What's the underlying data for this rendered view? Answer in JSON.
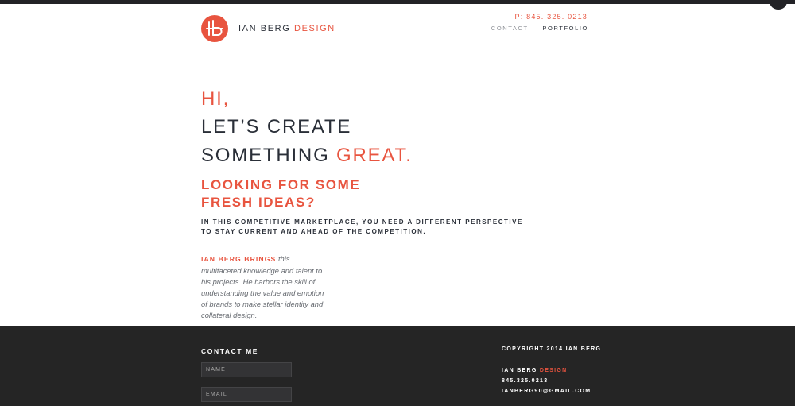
{
  "header": {
    "logo_initials": "ib",
    "brand_name": "IAN BERG",
    "brand_suffix": "DESIGN",
    "phone": "P:  845. 325. 0213",
    "nav": {
      "contact": "CONTACT",
      "portfolio": "PORTFOLIO"
    }
  },
  "hero": {
    "line1": "HI,",
    "line2": "LET’S CREATE",
    "line3_main": "SOMETHING",
    "line3_accent": "GREAT.",
    "sub1": "LOOKING FOR SOME",
    "sub2": "FRESH IDEAS?",
    "lede": "IN THIS COMPETITIVE MARKETPLACE, YOU NEED A DIFFERENT PERSPECTIVE TO STAY CURRENT AND AHEAD OF THE COMPETITION.",
    "bio_lead": "IAN BERG BRINGS",
    "bio_text": "this multifaceted knowledge and talent to his projects. He harbors the skill of understanding the value and emotion of brands to make stellar identity and collateral design."
  },
  "footer": {
    "contact_title": "CONTACT ME",
    "name_placeholder": "NAME",
    "email_placeholder": "EMAIL",
    "copyright": "COPYRIGHT 2014 IAN BERG",
    "brand_name": "IAN BERG",
    "brand_suffix": "DESIGN",
    "phone": "845.325.0213",
    "email": "IANBERG90@GMAIL.COM"
  },
  "colors": {
    "accent": "#e8543f",
    "dark": "#2a2f38",
    "footer_bg": "#252525"
  }
}
